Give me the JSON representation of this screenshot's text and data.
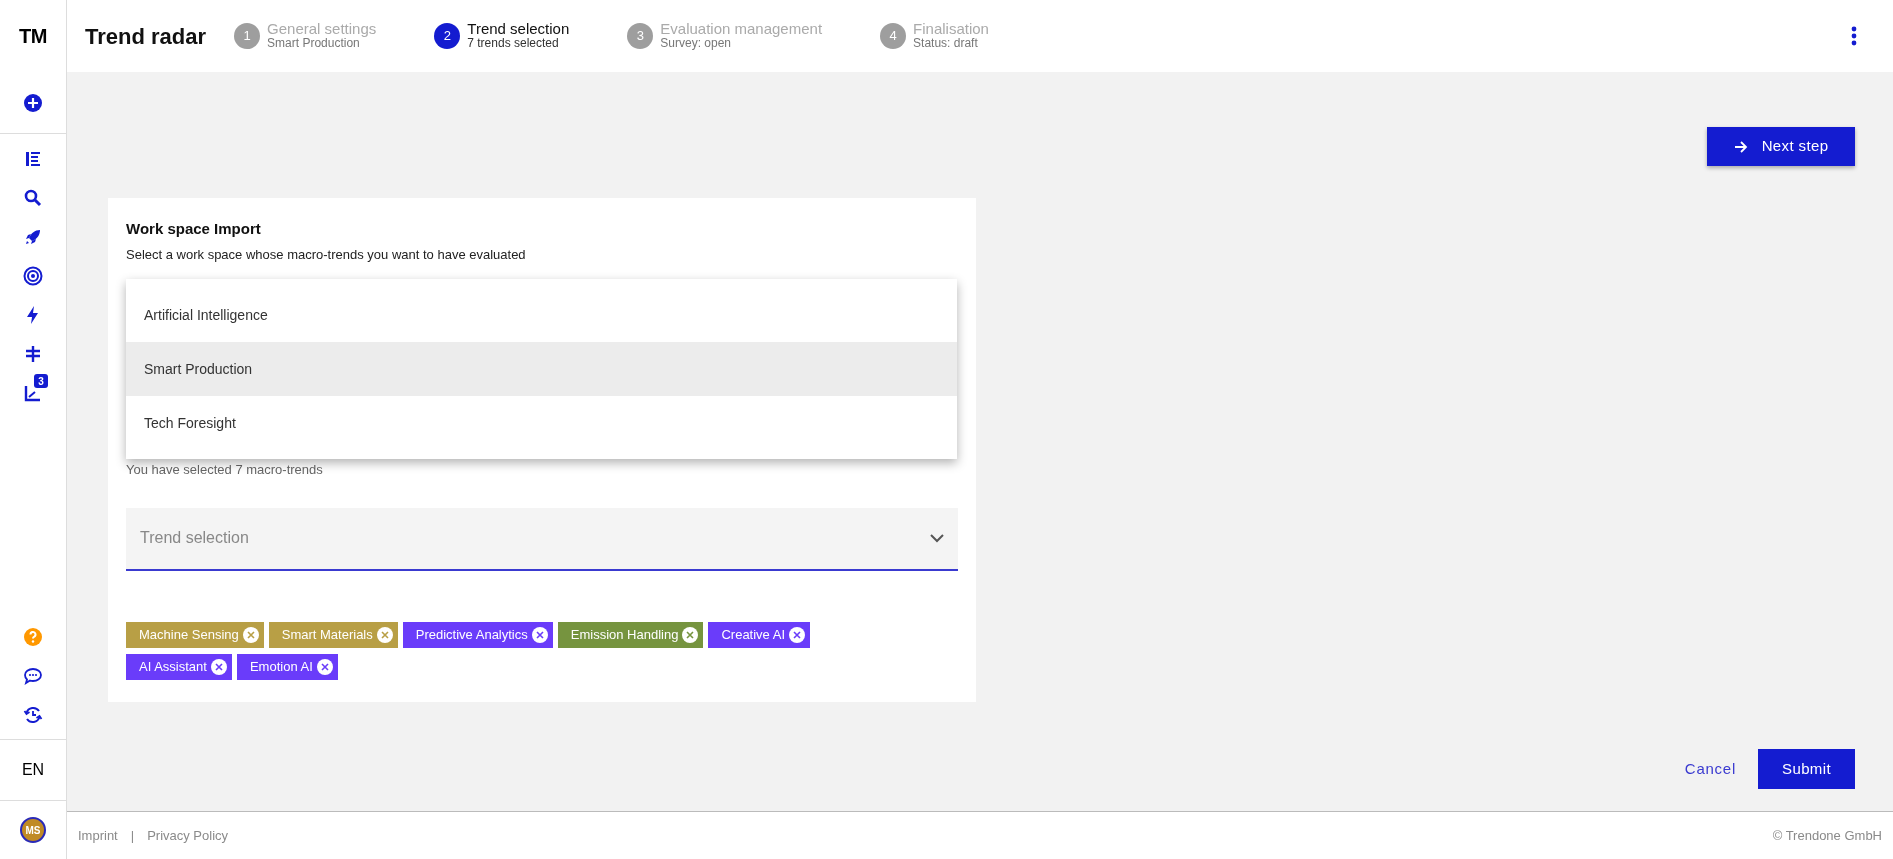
{
  "app": {
    "logo": "TM",
    "title": "Trend radar"
  },
  "steps": [
    {
      "number": "1",
      "label": "General settings",
      "sub": "Smart Production",
      "selected": false
    },
    {
      "number": "2",
      "label": "Trend selection",
      "sub": "7 trends selected",
      "selected": true
    },
    {
      "number": "3",
      "label": "Evaluation management",
      "sub": "Survey: open",
      "selected": false
    },
    {
      "number": "4",
      "label": "Finalisation",
      "sub": "Status: draft",
      "selected": false
    }
  ],
  "sidebar": {
    "top": [
      {
        "kind": "add"
      }
    ],
    "nav": [
      {
        "kind": "list"
      },
      {
        "kind": "search"
      },
      {
        "kind": "rocket"
      },
      {
        "kind": "target"
      },
      {
        "kind": "bolt"
      },
      {
        "kind": "signpost"
      },
      {
        "kind": "chart",
        "badge": "3"
      }
    ],
    "bottom": [
      {
        "kind": "help"
      },
      {
        "kind": "chat"
      },
      {
        "kind": "history"
      }
    ],
    "language": "EN",
    "avatar": "MS"
  },
  "next_button": "Next step",
  "card": {
    "title": "Work space Import",
    "subtitle": "Select a work space whose macro-trends you want to have evaluated",
    "workspace_options": [
      {
        "label": "Artificial Intelligence",
        "selected": false
      },
      {
        "label": "Smart Production",
        "selected": true
      },
      {
        "label": "Tech Foresight",
        "selected": false
      }
    ],
    "selected_info": "You have selected 7 macro-trends",
    "trend_field": {
      "placeholder": "Trend selection"
    },
    "chips": [
      {
        "label": "Machine Sensing",
        "color": "#b89f45"
      },
      {
        "label": "Smart Materials",
        "color": "#b89f45"
      },
      {
        "label": "Predictive Analytics",
        "color": "#6a3cfa"
      },
      {
        "label": "Emission Handling",
        "color": "#76943f"
      },
      {
        "label": "Creative AI",
        "color": "#6a3cfa"
      },
      {
        "label": "AI Assistant",
        "color": "#6a3cfa"
      },
      {
        "label": "Emotion AI",
        "color": "#6a3cfa"
      }
    ]
  },
  "actions": {
    "cancel": "Cancel",
    "submit": "Submit"
  },
  "footer": {
    "links": [
      "Imprint",
      "Privacy Policy"
    ],
    "separator": "|",
    "copyright": "© Trendone GmbH"
  }
}
